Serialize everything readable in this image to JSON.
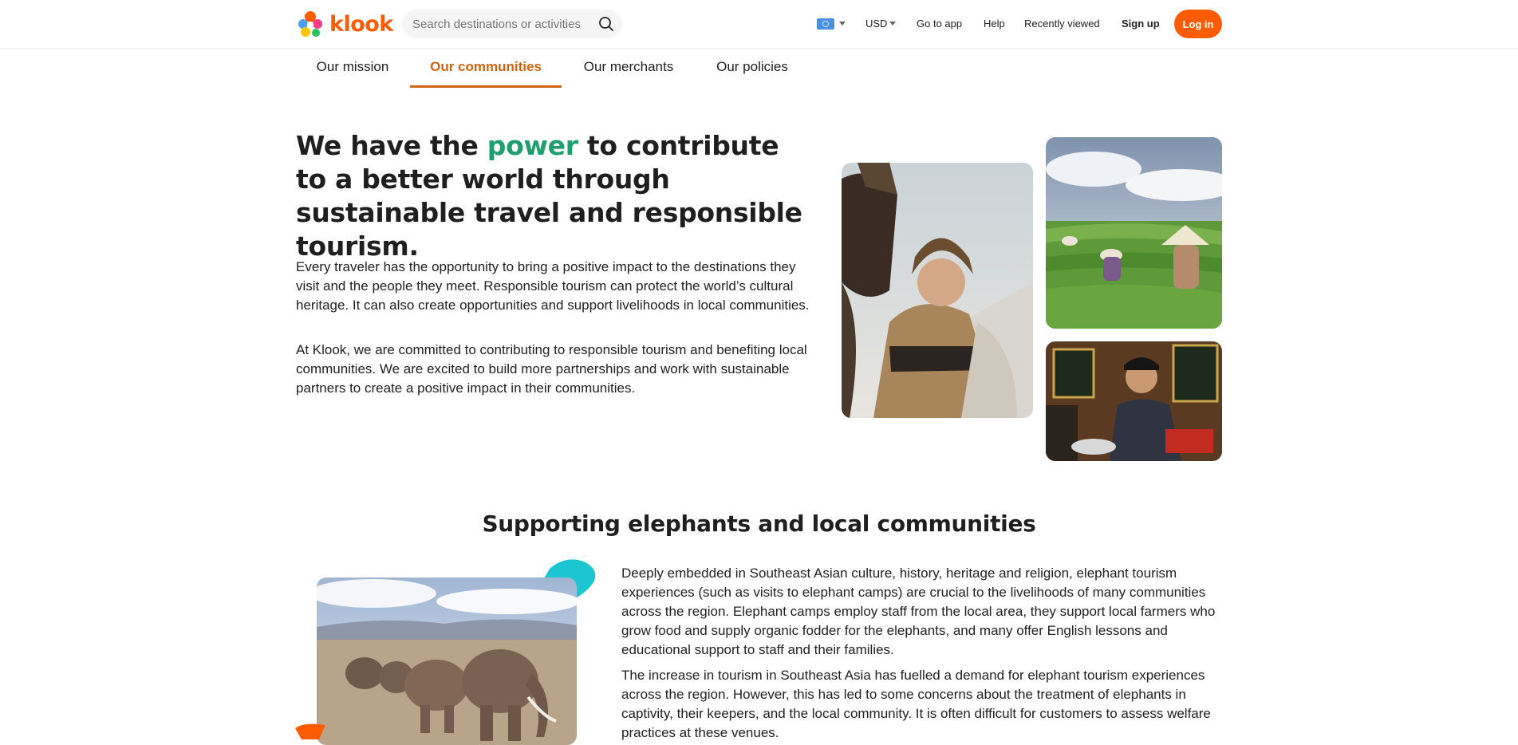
{
  "header": {
    "logo_text": "klook",
    "search_placeholder": "Search destinations or activities",
    "currency": "USD",
    "go_to_app": "Go to app",
    "help": "Help",
    "recently_viewed": "Recently viewed",
    "sign_up": "Sign up",
    "log_in": "Log in",
    "brand_color": "#ff5b00"
  },
  "tabs": [
    {
      "label": "Our mission",
      "active": false
    },
    {
      "label": "Our communities",
      "active": true
    },
    {
      "label": "Our merchants",
      "active": false
    },
    {
      "label": "Our policies",
      "active": false
    }
  ],
  "hero": {
    "title_before": "We have the ",
    "title_highlight": "power",
    "title_after": " to contribute to a better world through sustainable travel and responsible tourism.",
    "highlight_color": "#1f9e6e",
    "paragraph_1": "Every traveler has the opportunity to bring a positive impact to the destinations they visit and the people they meet. Responsible tourism can protect the world’s cultural heritage. It can also create opportunities and support livelihoods in local communities.",
    "paragraph_2": "At Klook, we are committed to contributing to responsible tourism and benefiting local communities. We are excited to build more partnerships and work with sustainable partners to create a positive impact in their communities."
  },
  "elephants_section": {
    "title": "Supporting elephants and local communities",
    "paragraph_1": "Deeply embedded in Southeast Asian culture, history, heritage and religion, elephant tourism experiences (such as visits to elephant camps) are crucial to the livelihoods of many communities across the region. Elephant camps employ staff from the local area, they support local farmers who grow food and supply organic fodder for the elephants, and many offer English lessons and educational support to staff and their families.",
    "paragraph_2": "The increase in tourism in Southeast Asia has fuelled a demand for elephant tourism experiences across the region. However, this has led to some concerns about the treatment of elephants in captivity, their keepers, and the local community. It is often difficult for customers to assess welfare practices at these venues."
  }
}
